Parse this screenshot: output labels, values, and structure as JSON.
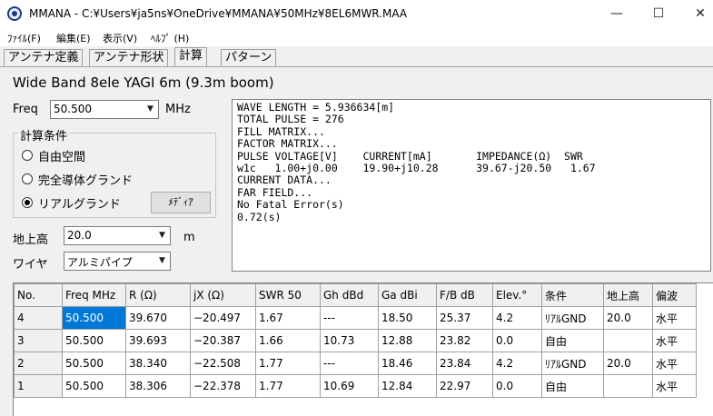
{
  "window": {
    "title": "MMANA - C:¥Users¥ja5ns¥OneDrive¥MMANA¥50MHz¥8EL6MWR.MAA",
    "minimize": "—",
    "maximize": "☐",
    "close": "✕"
  },
  "menu": [
    "ﾌｧｲﾙ(F)",
    "編集(E)",
    "表示(V)",
    "ﾍﾙﾌﾟ (H)"
  ],
  "tabs": [
    "アンテナ定義",
    "アンテナ形状",
    "計算",
    "パターン"
  ],
  "active_tab": "計算",
  "model_title": "Wide Band 8ele YAGI 6m (9.3m boom)",
  "freq": {
    "label": "Freq",
    "value": "50.500",
    "unit": "MHz"
  },
  "calc_conditions": {
    "title": "計算条件",
    "options": [
      "自由空間",
      "完全導体グランド",
      "リアルグランド"
    ],
    "selected": "リアルグランド",
    "media_button": "ﾒﾃﾞｨｱ"
  },
  "height": {
    "label": "地上高",
    "value": "20.0",
    "unit": "m"
  },
  "wire": {
    "label": "ワイヤ",
    "value": "アルミパイプ"
  },
  "output_lines": [
    "WAVE LENGTH = 5.936634[m]",
    "TOTAL PULSE = 276",
    "FILL MATRIX...",
    "FACTOR MATRIX...",
    "PULSE VOLTAGE[V]    CURRENT[mA]       IMPEDANCE(Ω)  SWR",
    "w1c   1.00+j0.00    19.90+j10.28      39.67-j20.50   1.67",
    "CURRENT DATA...",
    "FAR FIELD...",
    "No Fatal Error(s)",
    "0.72(s)"
  ],
  "table": {
    "headers": [
      "No.",
      "Freq MHz",
      "R (Ω)",
      "jX (Ω)",
      "SWR 50",
      "Gh dBd",
      "Ga dBi",
      "F/B dB",
      "Elev.°",
      "条件",
      "地上高",
      "偏波"
    ],
    "rows": [
      [
        "4",
        "50.500",
        "39.670",
        "−20.497",
        "1.67",
        "---",
        "18.50",
        "25.37",
        "4.2",
        "ﾘｱﾙGND",
        "20.0",
        "水平"
      ],
      [
        "3",
        "50.500",
        "39.693",
        "−20.387",
        "1.66",
        "10.73",
        "12.88",
        "23.82",
        "0.0",
        "自由",
        "",
        "水平"
      ],
      [
        "2",
        "50.500",
        "38.340",
        "−22.508",
        "1.77",
        "---",
        "18.46",
        "23.84",
        "4.2",
        "ﾘｱﾙGND",
        "20.0",
        "水平"
      ],
      [
        "1",
        "50.500",
        "38.306",
        "−22.378",
        "1.77",
        "10.69",
        "12.84",
        "22.97",
        "0.0",
        "自由",
        "",
        "水平"
      ]
    ]
  }
}
